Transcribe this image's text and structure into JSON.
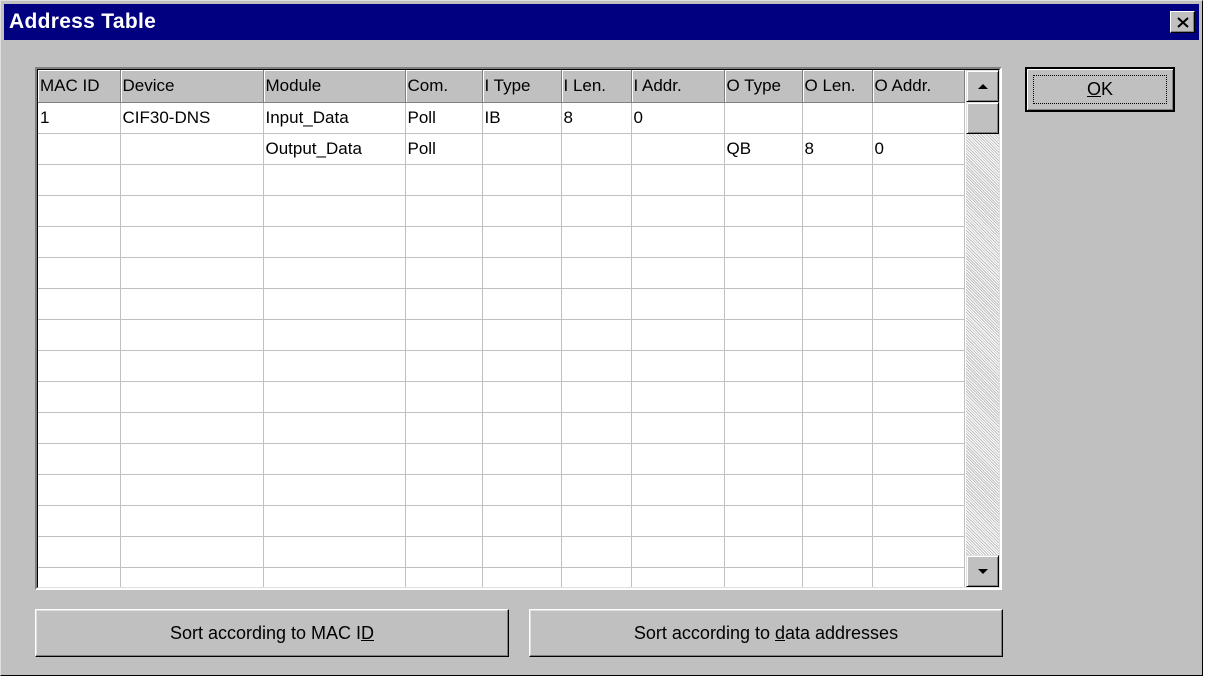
{
  "window": {
    "title": "Address Table",
    "colors": {
      "titlebar": "#000080",
      "face": "#c0c0c0"
    }
  },
  "table": {
    "columns": [
      "MAC ID",
      "Device",
      "Module",
      "Com.",
      "I Type",
      "I Len.",
      "I Addr.",
      "O Type",
      "O Len.",
      "O Addr."
    ],
    "rows": [
      [
        "1",
        "CIF30-DNS",
        "Input_Data",
        "Poll",
        "IB",
        "8",
        "0",
        "",
        "",
        ""
      ],
      [
        "",
        "",
        "Output_Data",
        "Poll",
        "",
        "",
        "",
        "QB",
        "8",
        "0"
      ]
    ],
    "empty_rows": 14
  },
  "buttons": {
    "ok": {
      "pre": "",
      "accel": "O",
      "post": "K"
    },
    "sort_mac": {
      "pre": "Sort according to MAC I",
      "accel": "D",
      "post": ""
    },
    "sort_addr": {
      "pre": "Sort according to ",
      "accel": "d",
      "post": "ata addresses"
    }
  },
  "icons": {
    "close": "close-icon",
    "scroll_up": "arrow-up-icon",
    "scroll_down": "arrow-down-icon"
  }
}
